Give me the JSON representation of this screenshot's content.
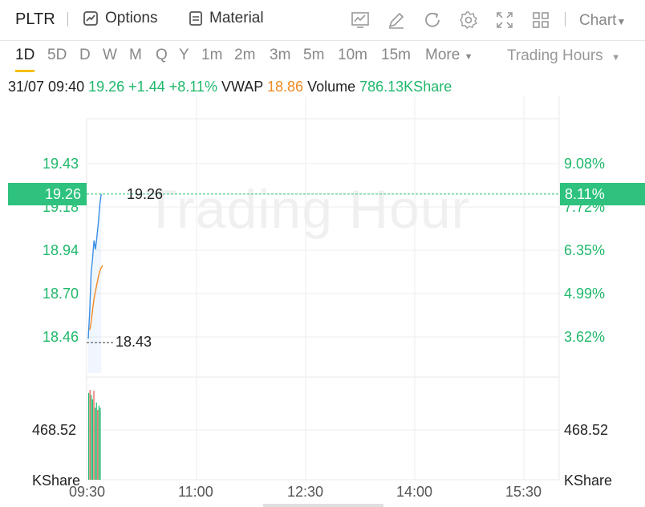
{
  "toolbar": {
    "symbol": "PLTR",
    "options_label": "Options",
    "material_label": "Material",
    "chart_label": "Chart"
  },
  "timeframes": [
    "1D",
    "5D",
    "D",
    "W",
    "M",
    "Q",
    "Y",
    "1m",
    "2m",
    "3m",
    "5m",
    "10m",
    "15m"
  ],
  "more_label": "More",
  "hours_label": "Trading Hours",
  "quote": {
    "datetime": "31/07 09:40",
    "price": "19.26",
    "change": "+1.44",
    "change_pct": "+8.11%",
    "vwap_label": "VWAP",
    "vwap": "18.86",
    "volume_label": "Volume",
    "volume": "786.13KShare"
  },
  "watermark": "Trading Hour",
  "price_axis": [
    "19.43",
    "19.18",
    "18.94",
    "18.70",
    "18.46"
  ],
  "pct_axis": [
    "9.08%",
    "7.72%",
    "6.35%",
    "4.99%",
    "3.62%"
  ],
  "current_price": "19.26",
  "current_pct": "8.11%",
  "high_label": "19.26",
  "low_label": "18.43",
  "volume_axis_left": [
    "468.52",
    "KShare"
  ],
  "volume_axis_right": [
    "468.52",
    "KShare"
  ],
  "time_axis": [
    "09:30",
    "11:00",
    "12:30",
    "14:00",
    "15:30"
  ],
  "colors": {
    "up": "#1fb86b",
    "vwap": "#f08a24",
    "price_line": "#3a8ee6",
    "tag": "#2ec27e"
  },
  "chart_data": {
    "type": "line",
    "series": [
      {
        "name": "",
        "values": [
          18.45,
          18.6,
          18.82,
          18.9,
          19.0,
          18.95,
          19.02,
          19.1,
          19.2,
          19.26
        ]
      },
      {
        "name": "",
        "values": [
          18.5,
          18.55,
          18.62,
          18.68,
          18.72,
          18.76,
          18.8,
          18.83,
          18.85,
          18.86
        ]
      }
    ],
    "volume": [
      440,
      468,
      420,
      380,
      460,
      300,
      350,
      280,
      320,
      300
    ],
    "ylim": [
      18.46,
      19.43
    ]
  }
}
